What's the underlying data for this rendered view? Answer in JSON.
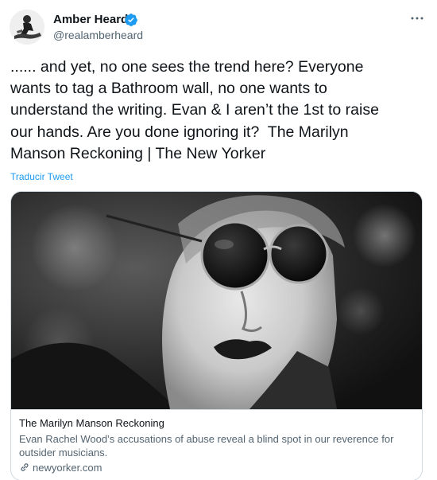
{
  "author": {
    "display_name": "Amber Heard",
    "handle": "@realamberheard",
    "verified": true,
    "avatar_icon": "profile-photo"
  },
  "menu": {
    "more_icon": "more-horizontal-icon",
    "more_glyph": "···"
  },
  "tweet": {
    "text": "...... and yet, no one sees the trend here? Everyone\nwants to tag a Bathroom wall, no one wants to\nunderstand the writing. Evan & I aren’t the 1st to raise\nour hands. Are you done ignoring it?  The Marilyn\nManson Reckoning | The New Yorker",
    "translate_label": "Traducir Tweet"
  },
  "link_card": {
    "image_icon": "article-photo",
    "title": "The Marilyn Manson Reckoning",
    "description": "Evan Rachel Wood’s accusations of abuse reveal a blind spot in our reverence for outsider musicians.",
    "domain": "newyorker.com",
    "domain_icon": "link-icon"
  },
  "colors": {
    "text_primary": "#0f1419",
    "text_secondary": "#536471",
    "accent_blue": "#1d9bf0",
    "border": "#cfd9de"
  }
}
